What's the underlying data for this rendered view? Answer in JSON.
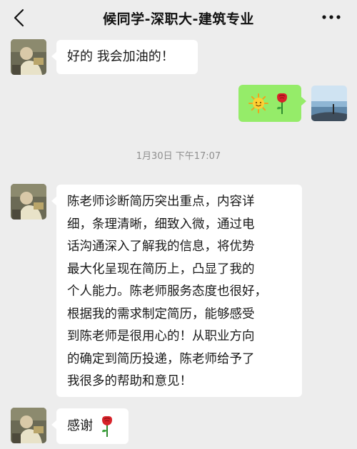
{
  "header": {
    "title": "候同学-深职大-建筑专业",
    "back_icon": "chevron-left-icon",
    "more_icon": "more-dots-icon"
  },
  "messages": [
    {
      "side": "left",
      "text": "好的 我会加油的！"
    },
    {
      "side": "right",
      "emojis": [
        "sun-emoji",
        "rose-emoji"
      ]
    },
    {
      "side": "left",
      "lines": [
        "陈老师诊断简历突出重点，内容详",
        "细，条理清晰，细致入微，通过电",
        "话沟通深入了解我的信息，将优势",
        "最大化呈现在简历上，凸显了我的",
        "个人能力。陈老师服务态度也很好，",
        "根据我的需求制定简历，能够感受",
        "到陈老师是很用心的！从职业方向",
        "的确定到简历投递，陈老师给予了",
        "我很多的帮助和意见！"
      ]
    },
    {
      "side": "left",
      "text": "感谢",
      "emojis": [
        "rose-emoji"
      ]
    }
  ],
  "timestamp": "1月30日 下午17:07",
  "colors": {
    "background": "#ededed",
    "bubble_in": "#ffffff",
    "bubble_out": "#95ec69",
    "text": "#191919",
    "meta": "#8e8e8e"
  }
}
